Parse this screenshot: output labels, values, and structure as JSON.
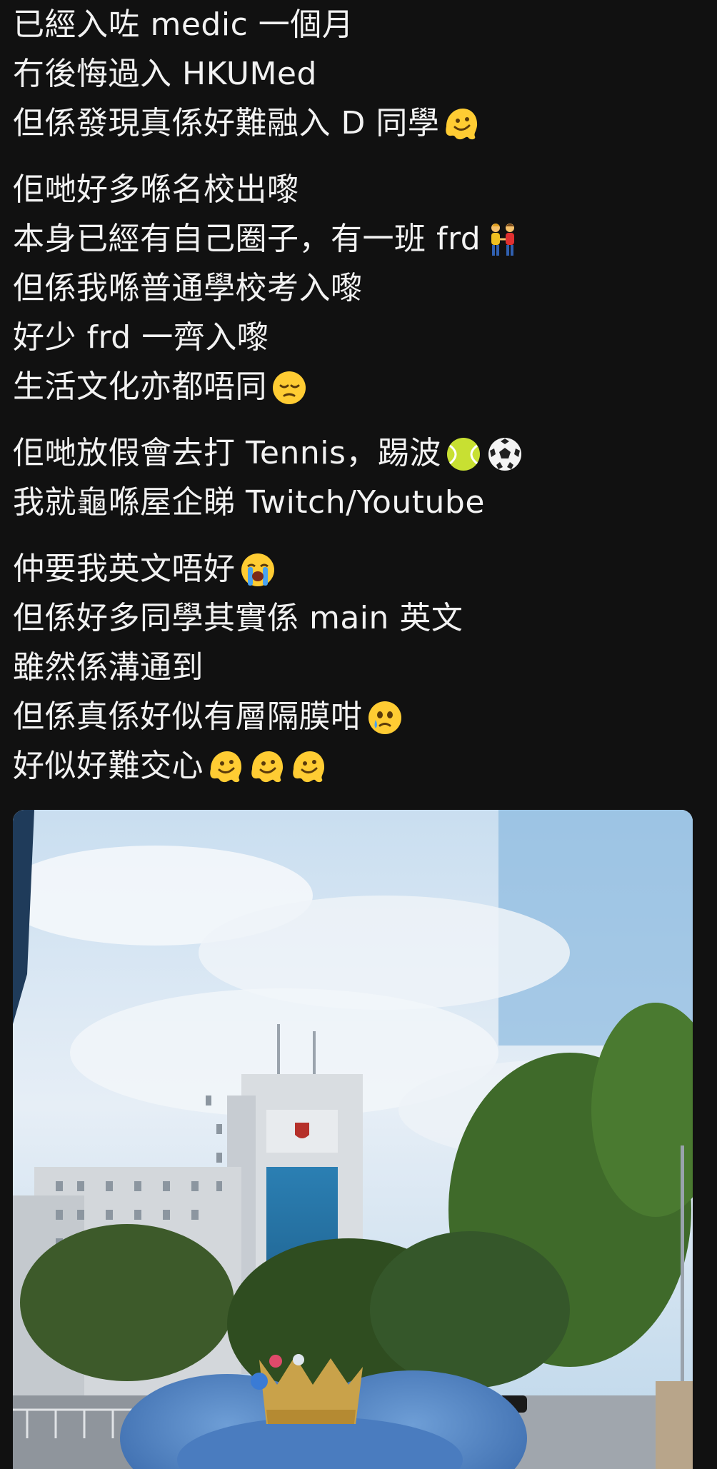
{
  "post": {
    "paragraphs": [
      {
        "lines": [
          {
            "text": "已經入咗 medic 一個月",
            "emojis": []
          },
          {
            "text": "冇後悔過入 HKUMed",
            "emojis": []
          },
          {
            "text": "但係發現真係好難融入 D 同學",
            "emojis": [
              "melting-face"
            ]
          }
        ]
      },
      {
        "lines": [
          {
            "text": "佢哋好多喺名校出嚟",
            "emojis": []
          },
          {
            "text": "本身已經有自己圈子，有一班 frd",
            "emojis": [
              "people-holding-hands"
            ]
          },
          {
            "text": "但係我喺普通學校考入嚟",
            "emojis": []
          },
          {
            "text": "好少 frd 一齊入嚟",
            "emojis": []
          },
          {
            "text": "生活文化亦都唔同",
            "emojis": [
              "pensive-face"
            ]
          }
        ]
      },
      {
        "lines": [
          {
            "text": "佢哋放假會去打 Tennis，踢波",
            "emojis": [
              "tennis-ball",
              "soccer-ball"
            ]
          },
          {
            "text": "我就龜喺屋企睇 Twitch/Youtube",
            "emojis": []
          }
        ]
      },
      {
        "lines": [
          {
            "text": "仲要我英文唔好",
            "emojis": [
              "loudly-crying-face"
            ]
          },
          {
            "text": "但係好多同學其實係 main 英文",
            "emojis": []
          },
          {
            "text": "雖然係溝通到",
            "emojis": []
          },
          {
            "text": "但係真係好似有層隔膜咁",
            "emojis": [
              "face-holding-back-tears"
            ]
          },
          {
            "text": "好似好難交心",
            "emojis": [
              "melting-face",
              "melting-face",
              "melting-face"
            ]
          }
        ]
      }
    ]
  },
  "photo": {
    "subject": "photo-hku-building-with-plush-toy"
  },
  "colors": {
    "background": "#111111",
    "text": "#f2f2f2",
    "emoji_yellow": "#ffcc33"
  }
}
